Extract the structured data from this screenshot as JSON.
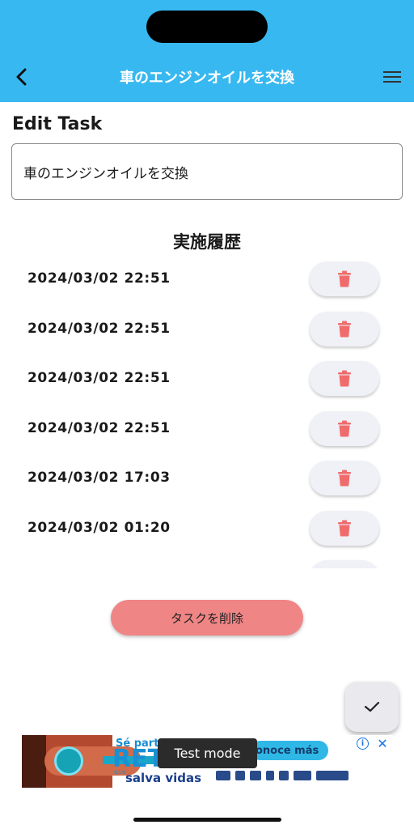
{
  "appbar": {
    "title": "車のエンジンオイルを交換",
    "back_icon": "chevron-left-icon",
    "menu_icon": "hamburger-menu-icon",
    "background_color": "#38b8f0"
  },
  "form": {
    "section_title": "Edit Task",
    "task_value": "車のエンジンオイルを交換"
  },
  "history": {
    "title": "実施履歴",
    "items": [
      {
        "date": "2024/03/02 22:51"
      },
      {
        "date": "2024/03/02 22:51"
      },
      {
        "date": "2024/03/02 22:51"
      },
      {
        "date": "2024/03/02 22:51"
      },
      {
        "date": "2024/03/02 17:03"
      },
      {
        "date": "2024/03/02 01:20"
      },
      {
        "date": ""
      }
    ],
    "delete_icon": "trash-icon",
    "delete_icon_color": "#f06c6c"
  },
  "actions": {
    "delete_task_label": "タスクを削除",
    "delete_task_color": "#f08585",
    "save_icon": "checkmark-icon"
  },
  "ad": {
    "headline_top": "Sé part",
    "headline_big": "RET",
    "small": "que",
    "subline": "salva vidas",
    "cta": "onoce más",
    "info_icon": "info-icon",
    "close_icon": "close-icon",
    "test_mode_label": "Test mode"
  }
}
